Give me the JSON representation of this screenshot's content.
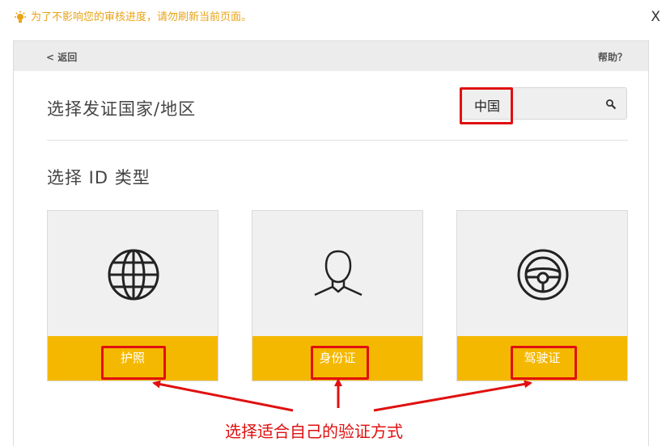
{
  "notice": {
    "text": "为了不影响您的审核进度，请勿刷新当前页面。",
    "close_label": "X",
    "color": "#e8a317"
  },
  "header": {
    "back_label": "< 返回",
    "help_label": "帮助？"
  },
  "country": {
    "title": "选择发证国家/地区",
    "selected": "中国"
  },
  "id_type": {
    "title": "选择 ID 类型",
    "options": [
      {
        "label": "护照",
        "icon": "globe-icon"
      },
      {
        "label": "身份证",
        "icon": "person-icon"
      },
      {
        "label": "驾驶证",
        "icon": "steering-wheel-icon"
      }
    ]
  },
  "annotation": {
    "text": "选择适合自己的验证方式",
    "color": "#e01010"
  },
  "colors": {
    "accent": "#f5b800"
  }
}
